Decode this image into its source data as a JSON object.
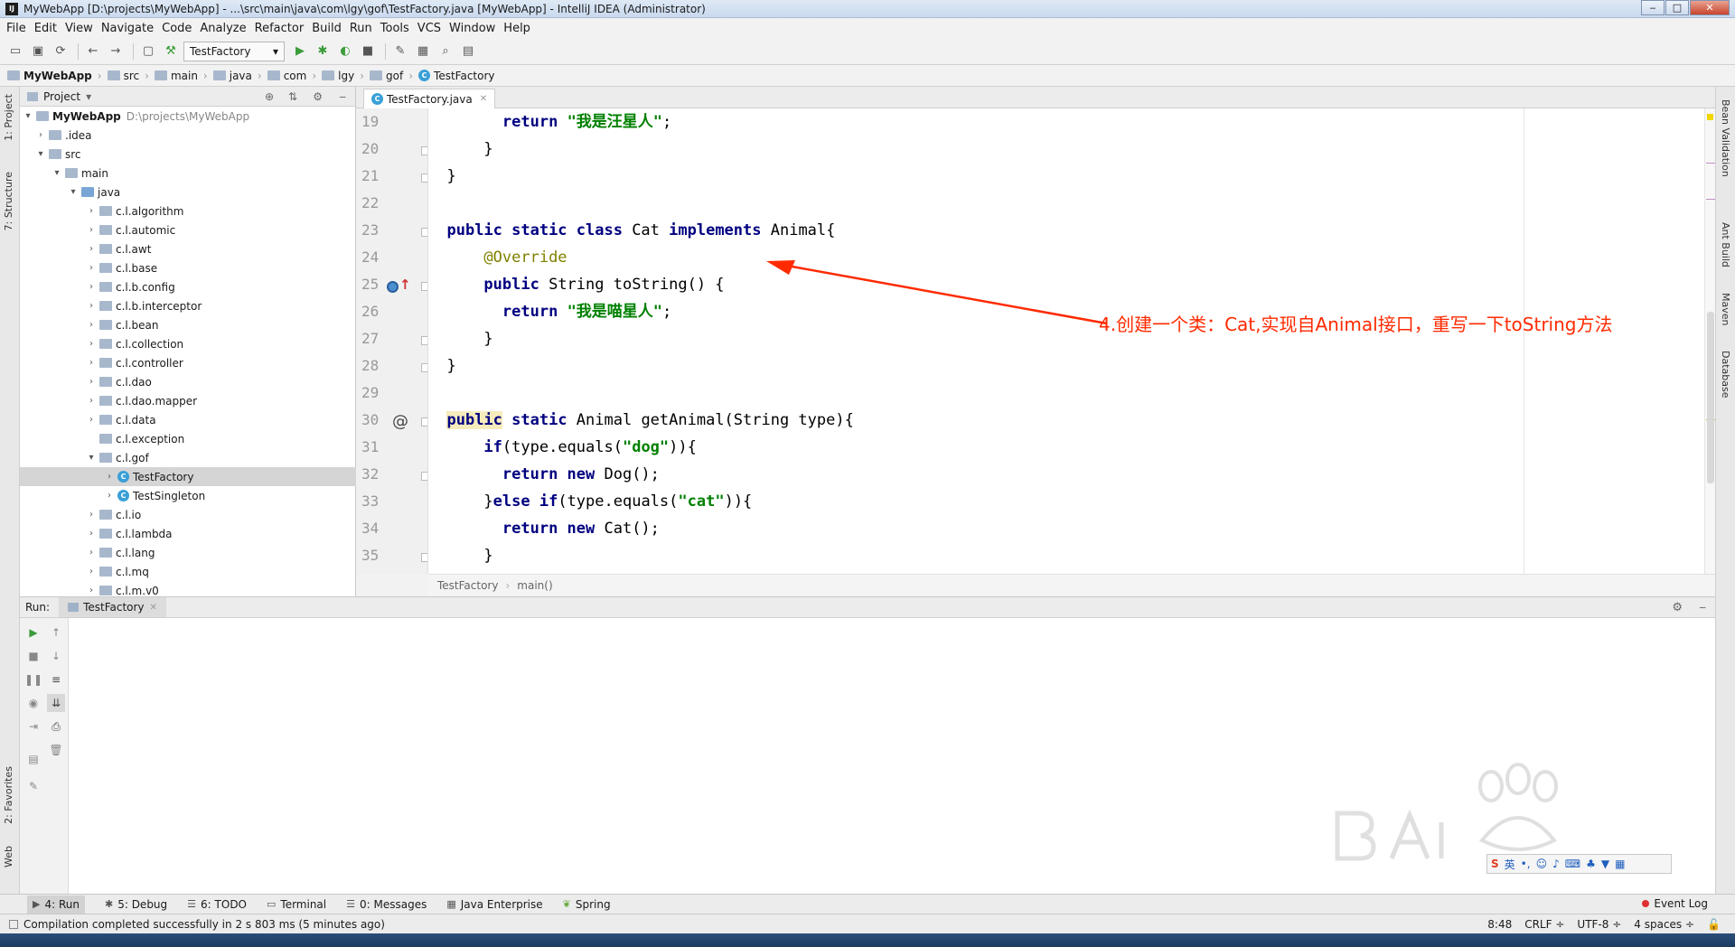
{
  "window": {
    "title": "MyWebApp [D:\\projects\\MyWebApp] - ...\\src\\main\\java\\com\\lgy\\gof\\TestFactory.java [MyWebApp] - IntelliJ IDEA (Administrator)",
    "app_icon": "IJ"
  },
  "menu": [
    "File",
    "Edit",
    "View",
    "Navigate",
    "Code",
    "Analyze",
    "Refactor",
    "Build",
    "Run",
    "Tools",
    "VCS",
    "Window",
    "Help"
  ],
  "toolbar": {
    "run_config": "TestFactory"
  },
  "navbar": {
    "crumbs": [
      "MyWebApp",
      "src",
      "main",
      "java",
      "com",
      "lgy",
      "gof",
      "TestFactory"
    ]
  },
  "side_tabs": {
    "project": "1: Project",
    "structure": "7: Structure",
    "favorites": "2: Favorites",
    "web": "Web"
  },
  "right_tabs": {
    "bean": "Bean Validation",
    "ant": "Ant Build",
    "maven": "Maven",
    "database": "Database"
  },
  "project_panel": {
    "header": "Project",
    "root_name": "MyWebApp",
    "root_path": "D:\\projects\\MyWebApp",
    "items": [
      {
        "label": ".idea",
        "depth": 1
      },
      {
        "label": "src",
        "depth": 1
      },
      {
        "label": "main",
        "depth": 2
      },
      {
        "label": "java",
        "depth": 3
      },
      {
        "label": "c.l.algorithm",
        "depth": 4
      },
      {
        "label": "c.l.automic",
        "depth": 4
      },
      {
        "label": "c.l.awt",
        "depth": 4
      },
      {
        "label": "c.l.base",
        "depth": 4
      },
      {
        "label": "c.l.b.config",
        "depth": 4
      },
      {
        "label": "c.l.b.interceptor",
        "depth": 4
      },
      {
        "label": "c.l.bean",
        "depth": 4
      },
      {
        "label": "c.l.collection",
        "depth": 4
      },
      {
        "label": "c.l.controller",
        "depth": 4
      },
      {
        "label": "c.l.dao",
        "depth": 4
      },
      {
        "label": "c.l.dao.mapper",
        "depth": 4
      },
      {
        "label": "c.l.data",
        "depth": 4
      },
      {
        "label": "c.l.exception",
        "depth": 4
      },
      {
        "label": "c.l.gof",
        "depth": 4
      },
      {
        "label": "TestFactory",
        "depth": 5
      },
      {
        "label": "TestSingleton",
        "depth": 5
      },
      {
        "label": "c.l.io",
        "depth": 4
      },
      {
        "label": "c.l.lambda",
        "depth": 4
      },
      {
        "label": "c.l.lang",
        "depth": 4
      },
      {
        "label": "c.l.mq",
        "depth": 4
      },
      {
        "label": "c.l.m.v0",
        "depth": 4
      }
    ]
  },
  "editor": {
    "tab": "TestFactory.java",
    "line_numbers": [
      "19",
      "20",
      "21",
      "22",
      "23",
      "24",
      "25",
      "26",
      "27",
      "28",
      "29",
      "30",
      "31",
      "32",
      "33",
      "34",
      "35"
    ],
    "code": {
      "l19": {
        "kw": "return",
        "str": "\"我是汪星人\"",
        "tail": ";"
      },
      "l20": "}",
      "l21": "}",
      "l23": {
        "kw1": "public static class",
        "name": " Cat ",
        "kw2": "implements",
        "tail": " Animal{"
      },
      "l24": "@Override",
      "l25": {
        "kw": "public",
        "tail": " String toString() {"
      },
      "l26": {
        "kw": "return",
        "str": "\"我是喵星人\"",
        "tail": ";"
      },
      "l27": "}",
      "l28": "}",
      "l30": {
        "kw1": "public",
        "kw2": " static",
        "tail": " Animal getAnimal(String type){"
      },
      "l31": {
        "kw": "if",
        "mid": "(type.equals(",
        "str": "\"dog\"",
        "tail": ")){"
      },
      "l32": {
        "kw": "return new",
        "tail": " Dog();"
      },
      "l33": {
        "pre": "}",
        "kw": "else if",
        "mid": "(type.equals(",
        "str": "\"cat\"",
        "tail": ")){"
      },
      "l34": {
        "kw": "return new",
        "tail": " Cat();"
      },
      "l35": "}"
    },
    "gutter_at": "@",
    "breadcrumb": [
      "TestFactory",
      "main()"
    ]
  },
  "annotation": "4.创建一个类：Cat,实现自Animal接口，重写一下toString方法",
  "run_panel": {
    "label": "Run:",
    "tab": "TestFactory"
  },
  "bottom_tabs": [
    {
      "label": "4: Run",
      "icon": "run-icon"
    },
    {
      "label": "5: Debug",
      "icon": "debug-icon"
    },
    {
      "label": "6: TODO",
      "icon": "todo-icon"
    },
    {
      "label": "Terminal",
      "icon": "terminal-icon"
    },
    {
      "label": "0: Messages",
      "icon": "messages-icon"
    },
    {
      "label": "Java Enterprise",
      "icon": "java-enterprise-icon"
    },
    {
      "label": "Spring",
      "icon": "spring-icon"
    }
  ],
  "event_log": "Event Log",
  "status": {
    "message": "Compilation completed successfully in 2 s 803 ms (5 minutes ago)",
    "position": "8:48",
    "line_sep": "CRLF ÷",
    "encoding": "UTF-8 ÷",
    "indent": "4 spaces ÷"
  },
  "ime": {
    "lang": "英"
  },
  "colors": {
    "annotation": "#ff2a00",
    "keyword": "#000080",
    "string": "#008000",
    "annotation_code": "#808000"
  }
}
